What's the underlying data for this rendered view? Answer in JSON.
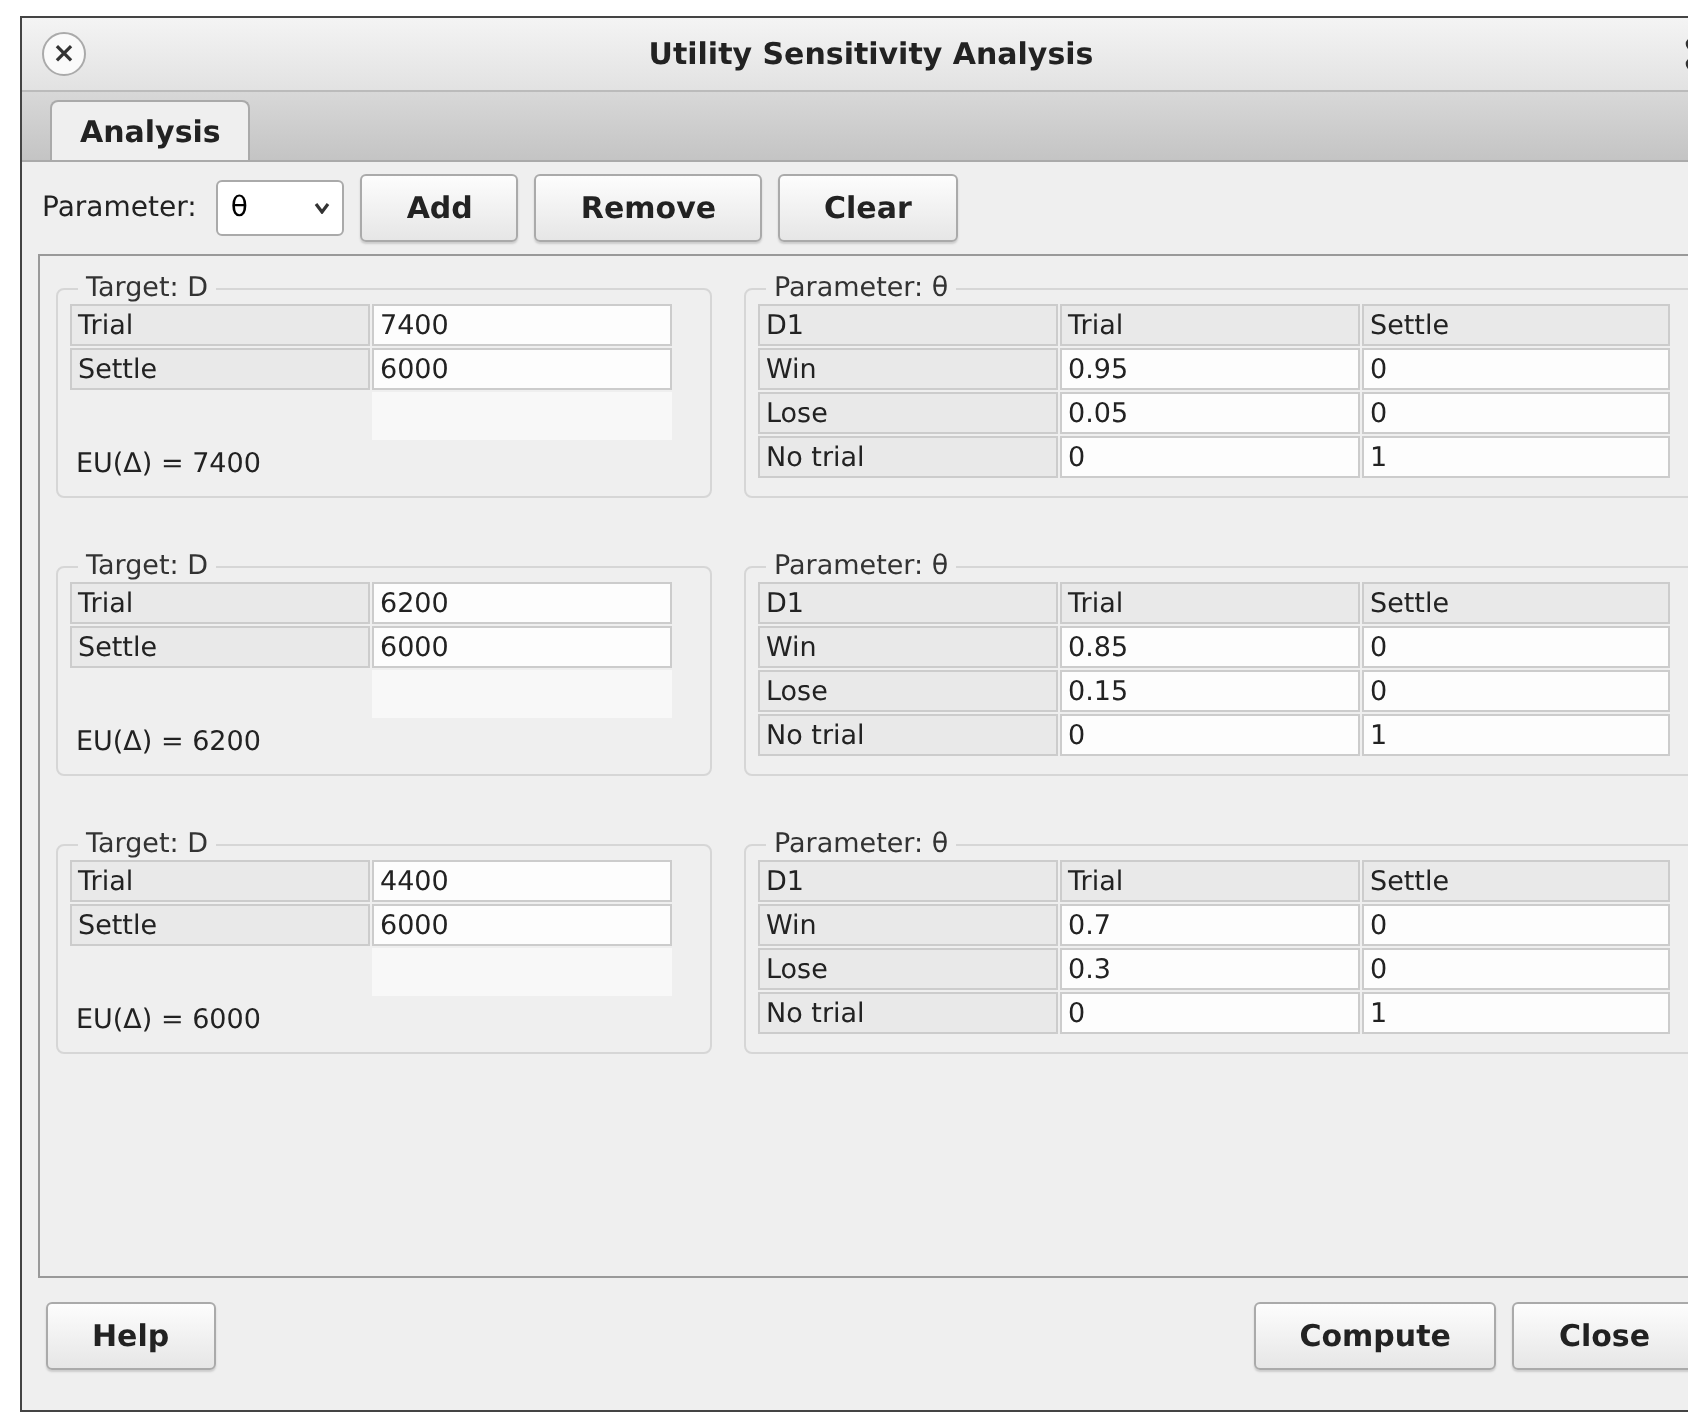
{
  "window": {
    "title": "Utility Sensitivity Analysis",
    "close_symbol": "×"
  },
  "tabs": [
    {
      "label": "Analysis",
      "selected": true
    }
  ],
  "toolbar": {
    "parameter_label": "Parameter:",
    "parameter_value": "θ",
    "buttons": [
      "Add",
      "Remove",
      "Clear"
    ]
  },
  "sections": [
    {
      "target": {
        "title": "Target: D",
        "rows": [
          [
            "Trial",
            "7400"
          ],
          [
            "Settle",
            "6000"
          ]
        ],
        "result": "EU(Δ) = 7400"
      },
      "parameter": {
        "title": "Parameter: θ",
        "header": [
          "D1",
          "Trial",
          "Settle"
        ],
        "rows": [
          [
            "Win",
            "0.95",
            "0"
          ],
          [
            "Lose",
            "0.05",
            "0"
          ],
          [
            "No trial",
            "0",
            "1"
          ]
        ]
      }
    },
    {
      "target": {
        "title": "Target: D",
        "rows": [
          [
            "Trial",
            "6200"
          ],
          [
            "Settle",
            "6000"
          ]
        ],
        "result": "EU(Δ) = 6200"
      },
      "parameter": {
        "title": "Parameter: θ",
        "header": [
          "D1",
          "Trial",
          "Settle"
        ],
        "rows": [
          [
            "Win",
            "0.85",
            "0"
          ],
          [
            "Lose",
            "0.15",
            "0"
          ],
          [
            "No trial",
            "0",
            "1"
          ]
        ]
      }
    },
    {
      "target": {
        "title": "Target: D",
        "rows": [
          [
            "Trial",
            "4400"
          ],
          [
            "Settle",
            "6000"
          ]
        ],
        "result": "EU(Δ) = 6000"
      },
      "parameter": {
        "title": "Parameter: θ",
        "header": [
          "D1",
          "Trial",
          "Settle"
        ],
        "rows": [
          [
            "Win",
            "0.7",
            "0"
          ],
          [
            "Lose",
            "0.3",
            "0"
          ],
          [
            "No trial",
            "0",
            "1"
          ]
        ]
      }
    }
  ],
  "footer": {
    "left_buttons": [
      "Help"
    ],
    "right_buttons": [
      "Compute",
      "Close"
    ]
  }
}
